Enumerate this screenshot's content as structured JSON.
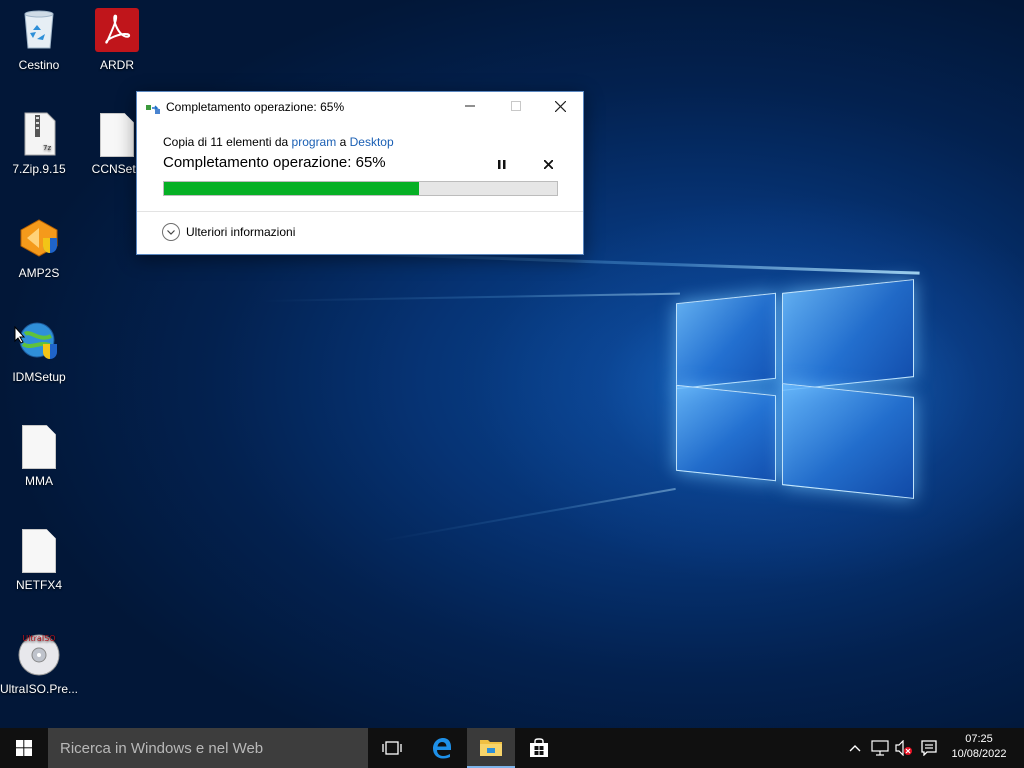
{
  "desktop": {
    "icons": [
      {
        "label": "Cestino",
        "icon": "recycle-bin-icon"
      },
      {
        "label": "ARDR",
        "icon": "acrobat-reader-icon"
      },
      {
        "label": "7.Zip.9.15",
        "icon": "zip-file-icon"
      },
      {
        "label": "CCNSetu",
        "icon": "file-icon"
      },
      {
        "label": "AMP2S",
        "icon": "installer-icon"
      },
      {
        "label": "IDMSetup",
        "icon": "idm-installer-icon"
      },
      {
        "label": "MMA",
        "icon": "file-icon"
      },
      {
        "label": "NETFX4",
        "icon": "file-icon"
      },
      {
        "label": "UltraISO.Pre...",
        "icon": "ultraiso-icon",
        "logo_text": "UltraISO"
      }
    ]
  },
  "dialog": {
    "title": "Completamento operazione: 65%",
    "copy_prefix": "Copia di 11 elementi da",
    "source": "program",
    "connector": "a",
    "destination": "Desktop",
    "status": "Completamento operazione: 65%",
    "progress_percent": 65,
    "more_info_label": "Ulteriori informazioni",
    "progress_color": "#06b025"
  },
  "taskbar": {
    "search_placeholder": "Ricerca in Windows e nel Web",
    "time": "07:25",
    "date": "10/08/2022"
  }
}
